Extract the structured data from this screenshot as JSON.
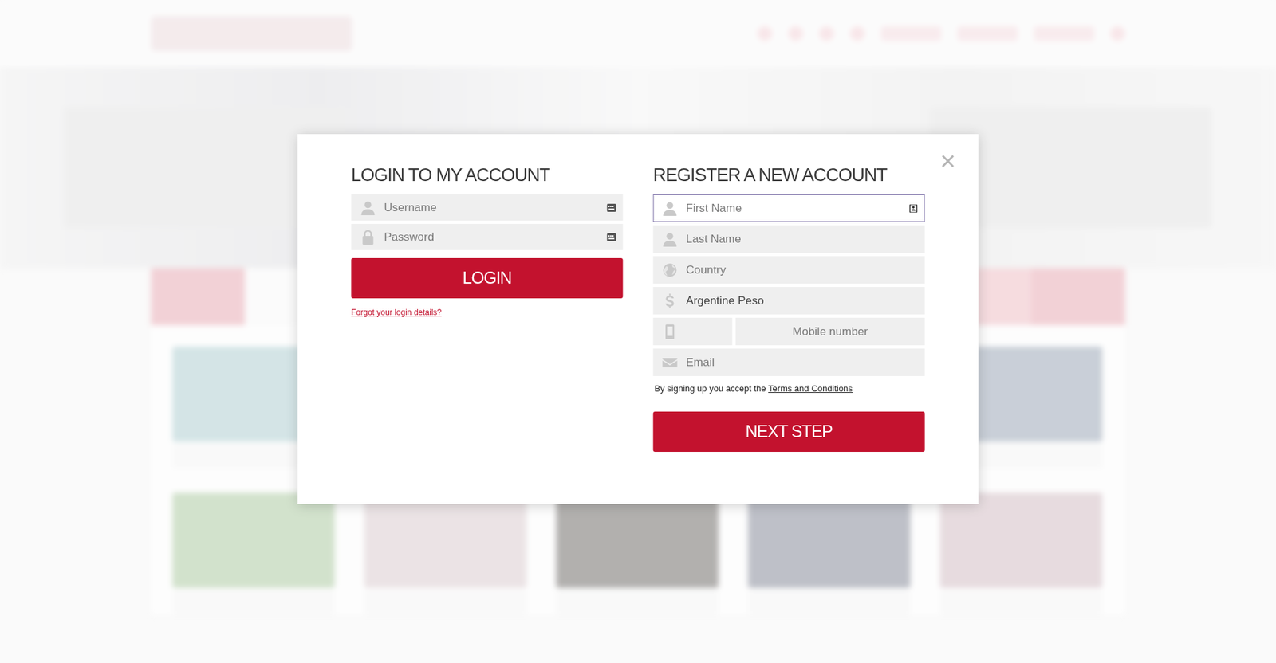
{
  "modal": {
    "close": "×",
    "login": {
      "title": "LOGIN TO MY ACCOUNT",
      "fields": [
        {
          "kind": "username",
          "placeholder": "Username"
        },
        {
          "kind": "password",
          "placeholder": "Password"
        }
      ],
      "button": "LOGIN",
      "forgot": "Forgot your login details?"
    },
    "register": {
      "title": "REGISTER A NEW ACCOUNT",
      "fields": [
        {
          "kind": "first-name",
          "placeholder": "First Name",
          "focused": true
        },
        {
          "kind": "last-name",
          "placeholder": "Last Name",
          "focused": false
        },
        {
          "kind": "country",
          "placeholder": "Country",
          "focused": false
        },
        {
          "kind": "currency",
          "value": "Argentine Peso",
          "focused": false
        },
        {
          "kind": "phone",
          "prefix": "",
          "placeholder": "Mobile number",
          "focused": false
        },
        {
          "kind": "email",
          "placeholder": "Email",
          "focused": false
        }
      ],
      "terms_text": "By signing up you accept the ",
      "terms_link": "Terms and Conditions",
      "button": "NEXT STEP"
    }
  }
}
